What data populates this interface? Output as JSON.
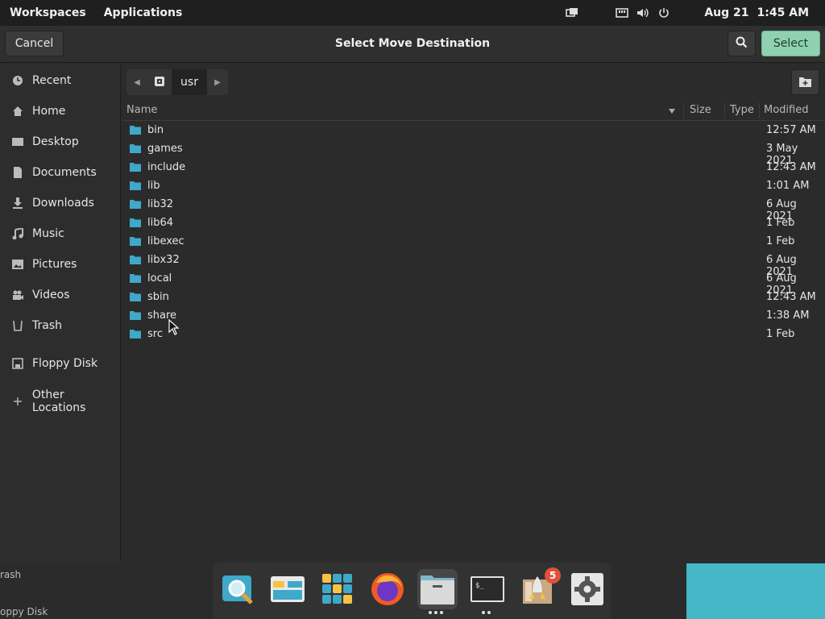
{
  "topbar": {
    "workspaces": "Workspaces",
    "applications": "Applications",
    "date": "Aug 21",
    "time": "1:45 AM"
  },
  "dialog": {
    "title": "Select Move Destination",
    "cancel_label": "Cancel",
    "select_label": "Select"
  },
  "sidebar": {
    "items": [
      {
        "label": "Recent",
        "icon": "clock-icon"
      },
      {
        "label": "Home",
        "icon": "home-icon"
      },
      {
        "label": "Desktop",
        "icon": "desktop-icon"
      },
      {
        "label": "Documents",
        "icon": "document-icon"
      },
      {
        "label": "Downloads",
        "icon": "download-icon"
      },
      {
        "label": "Music",
        "icon": "music-icon"
      },
      {
        "label": "Pictures",
        "icon": "picture-icon"
      },
      {
        "label": "Videos",
        "icon": "video-icon"
      },
      {
        "label": "Trash",
        "icon": "trash-icon"
      },
      {
        "label": "Floppy Disk",
        "icon": "disk-icon"
      },
      {
        "label": "Other Locations",
        "icon": "plus-icon"
      }
    ]
  },
  "pathbar": {
    "current": "usr"
  },
  "columns": {
    "name": "Name",
    "size": "Size",
    "type": "Type",
    "modified": "Modified"
  },
  "files": [
    {
      "name": "bin",
      "modified": "12:57 AM"
    },
    {
      "name": "games",
      "modified": "3 May 2021"
    },
    {
      "name": "include",
      "modified": "12:43 AM"
    },
    {
      "name": "lib",
      "modified": "1:01 AM"
    },
    {
      "name": "lib32",
      "modified": "6 Aug 2021"
    },
    {
      "name": "lib64",
      "modified": "1 Feb"
    },
    {
      "name": "libexec",
      "modified": "1 Feb"
    },
    {
      "name": "libx32",
      "modified": "6 Aug 2021"
    },
    {
      "name": "local",
      "modified": "6 Aug 2021"
    },
    {
      "name": "sbin",
      "modified": "12:43 AM"
    },
    {
      "name": "share",
      "modified": "1:38 AM"
    },
    {
      "name": "src",
      "modified": "1 Feb"
    }
  ],
  "background": {
    "ghost1": "rash",
    "ghost2": "oppy Disk"
  },
  "dock": {
    "badge": "5"
  },
  "colors": {
    "accent": "#8fd1b0",
    "folder": "#3ea9c9",
    "badge": "#e0503c"
  }
}
